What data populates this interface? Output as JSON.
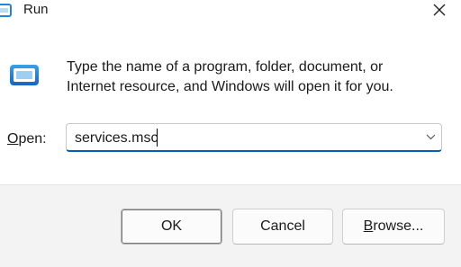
{
  "window": {
    "title": "Run",
    "close_icon": "close-icon"
  },
  "icons": {
    "app": "run-app-icon",
    "title": "run-title-icon"
  },
  "description": {
    "line1": "Type the name of a program, folder, document, or",
    "line2": "Internet resource, and Windows will open it for you."
  },
  "open": {
    "label_accel": "O",
    "label_rest": "pen:",
    "value": "services.msc",
    "dropdown_icon": "chevron-down-icon"
  },
  "buttons": {
    "ok": "OK",
    "cancel": "Cancel",
    "browse_accel": "B",
    "browse_rest": "rowse..."
  },
  "colors": {
    "accent": "#005fb8",
    "footer_bg": "#f3f3f3",
    "icon_blue": "#1e88d6"
  }
}
